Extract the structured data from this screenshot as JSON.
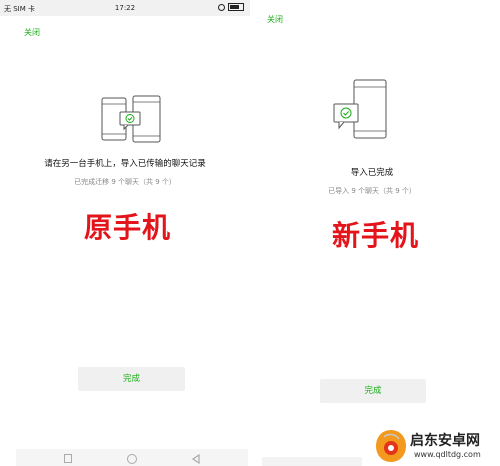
{
  "left": {
    "status": {
      "carrier": "无 SIM 卡",
      "time": "17:22"
    },
    "close": "关闭",
    "title": "请在另一台手机上，导入已传输的聊天记录",
    "sub": "已完成迁移 9 个聊天（共 9 个）",
    "overlay": "原手机",
    "done": "完成"
  },
  "right": {
    "close": "关闭",
    "title": "导入已完成",
    "sub": "已导入 9 个聊天（共 9 个）",
    "overlay": "新手机",
    "done": "完成"
  },
  "watermark": {
    "name": "启东安卓网",
    "url": "www.qdltdg.com"
  },
  "colors": {
    "accent": "#1aad19",
    "overlay": "#e3141a"
  }
}
